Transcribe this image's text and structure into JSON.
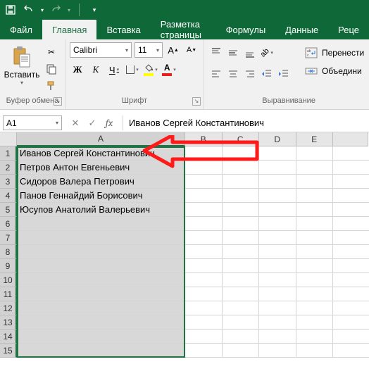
{
  "quick_access": {
    "save": "save",
    "undo": "undo",
    "redo": "redo",
    "customize": "customize"
  },
  "tabs": {
    "file": "Файл",
    "home": "Главная",
    "insert": "Вставка",
    "layout": "Разметка страницы",
    "formulas": "Формулы",
    "data": "Данные",
    "review": "Реце"
  },
  "ribbon": {
    "clipboard": {
      "paste": "Вставить",
      "group_label": "Буфер обмена"
    },
    "font": {
      "name": "Calibri",
      "size": "11",
      "bold": "Ж",
      "italic": "К",
      "underline": "Ч",
      "increase_label": "A",
      "decrease_label": "A",
      "fill_letter": "А",
      "font_color_letter": "А",
      "group_label": "Шрифт"
    },
    "alignment": {
      "wrap": "Перенести",
      "merge": "Объедини",
      "group_label": "Выравнивание"
    }
  },
  "name_box": "A1",
  "formula_value": "Иванов Сергей Константинович",
  "columns": [
    "A",
    "B",
    "C",
    "D",
    "E"
  ],
  "col_widths": {
    "A": 239,
    "other": 52.5
  },
  "rows": [
    1,
    2,
    3,
    4,
    5,
    6,
    7,
    8,
    9,
    10,
    11,
    12,
    13,
    14,
    15
  ],
  "colA_data": [
    "Иванов Сергей Константинович",
    "Петров Антон Евгеньевич",
    "Сидоров Валера Петрович",
    "Панов Геннайдий Борисович",
    "Юсупов Анатолий Валерьевич",
    "",
    "",
    "",
    "",
    "",
    "",
    "",
    "",
    "",
    ""
  ],
  "selection": {
    "col": "A",
    "rows": [
      1,
      15
    ]
  },
  "annotation": {
    "type": "arrow",
    "color": "#ff1a1a"
  }
}
